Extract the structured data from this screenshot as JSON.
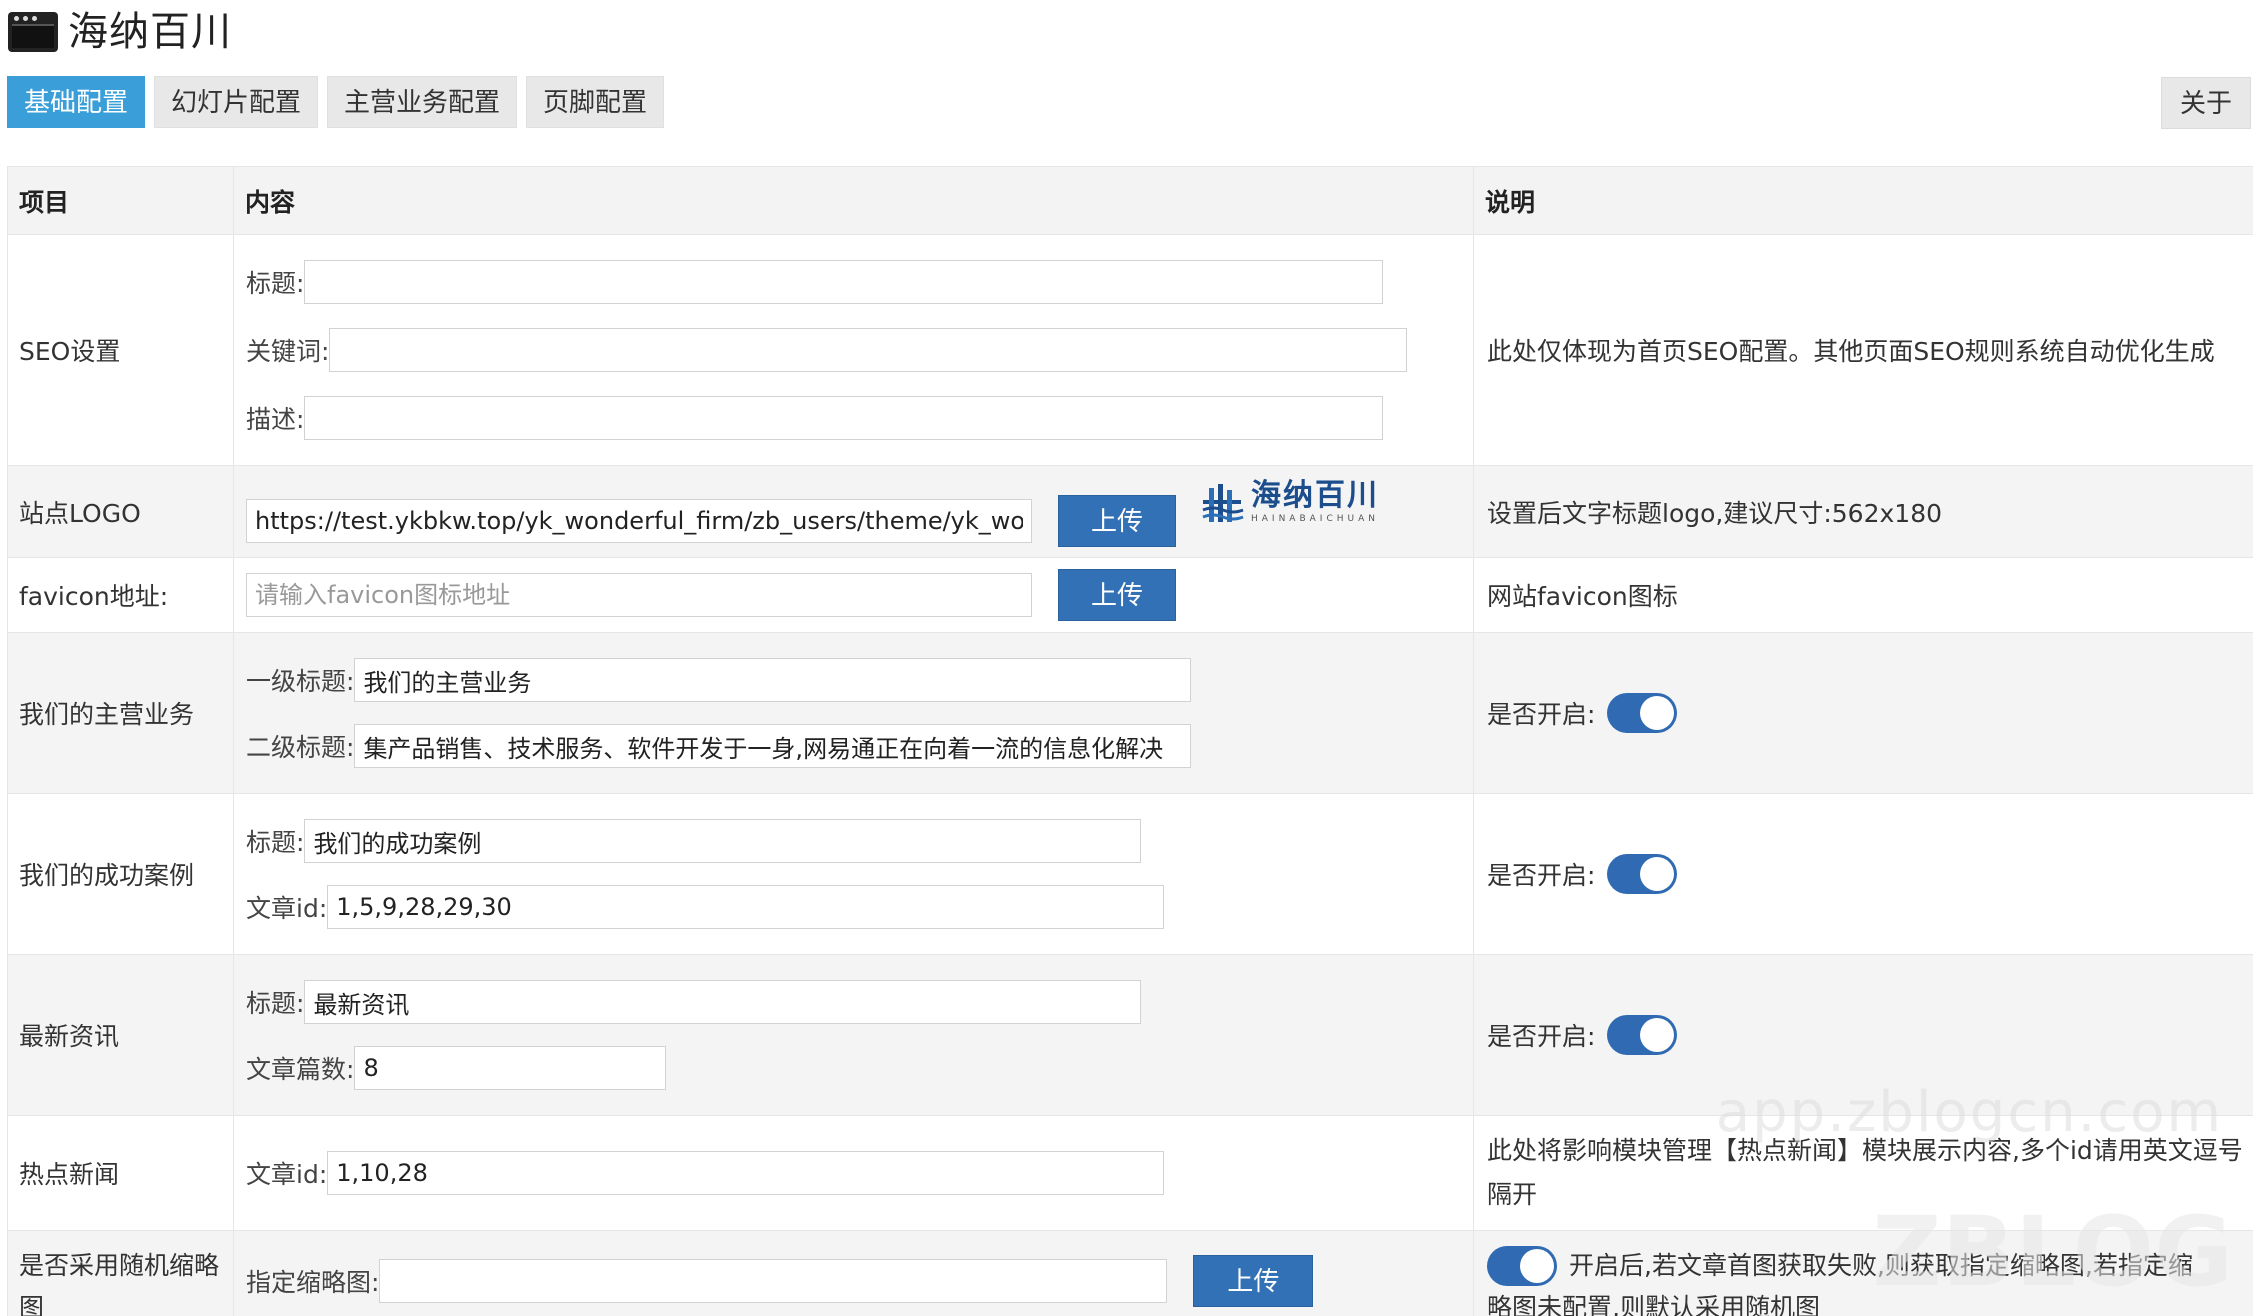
{
  "app": {
    "title": "海纳百川",
    "icon": "window-icon"
  },
  "tabs": [
    {
      "label": "基础配置",
      "active": true
    },
    {
      "label": "幻灯片配置",
      "active": false
    },
    {
      "label": "主营业务配置",
      "active": false
    },
    {
      "label": "页脚配置",
      "active": false
    }
  ],
  "about_label": "关于",
  "table": {
    "headers": {
      "item": "项目",
      "content": "内容",
      "desc": "说明"
    },
    "seo": {
      "item": "SEO设置",
      "title_label": "标题:",
      "title_value": "",
      "keywords_label": "关键词:",
      "keywords_value": "",
      "desc_label": "描述:",
      "desc_value": "",
      "note": "此处仅体现为首页SEO配置。其他页面SEO规则系统自动优化生成"
    },
    "logo": {
      "item": "站点LOGO",
      "url_value": "https://test.ykbkw.top/yk_wonderful_firm/zb_users/theme/yk_wonderful_",
      "upload_label": "上传",
      "preview_cn": "海纳百川",
      "preview_en": "HAINABAICHUAN",
      "note": "设置后文字标题logo,建议尺寸:562x180"
    },
    "favicon": {
      "item": "favicon地址:",
      "placeholder": "请输入favicon图标地址",
      "upload_label": "上传",
      "note": "网站favicon图标"
    },
    "business": {
      "item": "我们的主营业务",
      "l1_label": "一级标题:",
      "l1_value": "我们的主营业务",
      "l2_label": "二级标题:",
      "l2_value": "集产品销售、技术服务、软件开发于一身,网易通正在向着一流的信息化解决",
      "toggle_label": "是否开启:",
      "enabled": true
    },
    "cases": {
      "item": "我们的成功案例",
      "title_label": "标题:",
      "title_value": "我们的成功案例",
      "ids_label": "文章id:",
      "ids_value": "1,5,9,28,29,30",
      "toggle_label": "是否开启:",
      "enabled": true
    },
    "news": {
      "item": "最新资讯",
      "title_label": "标题:",
      "title_value": "最新资讯",
      "count_label": "文章篇数:",
      "count_value": "8",
      "toggle_label": "是否开启:",
      "enabled": true
    },
    "hot": {
      "item": "热点新闻",
      "ids_label": "文章id:",
      "ids_value": "1,10,28",
      "note_line1": "此处将影响模块管理【热点新闻】模块展示内容,多个id请用英文逗号",
      "note_line2": "隔开"
    },
    "thumb": {
      "item_line1": "是否采用随机缩略",
      "item_line2": "图",
      "label": "指定缩略图:",
      "value": "",
      "upload_label": "上传",
      "enabled": true,
      "note_line1": "开启后,若文章首图获取失败,则获取指定缩略图,若指定缩",
      "note_line2": "略图未配置,则默认采用随机图"
    }
  },
  "watermark": {
    "text": "app.zblogcn.com",
    "text2": "ZBLOG"
  },
  "colors": {
    "accent": "#3a9fd8",
    "button": "#3271b5",
    "toggle": "#2f6ab3"
  }
}
